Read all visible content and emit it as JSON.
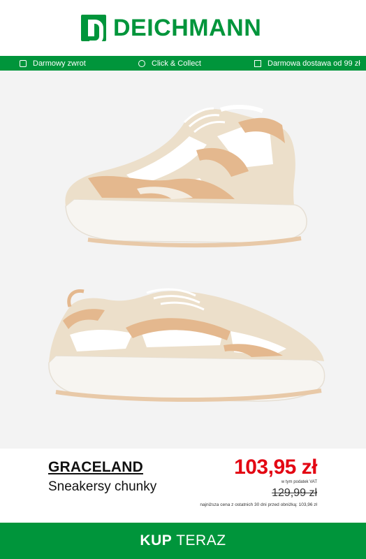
{
  "brand_logo": {
    "name": "DEICHMANN",
    "color": "#00953b"
  },
  "benefits": [
    {
      "icon": "return-box-icon",
      "label": "Darmowy zwrot"
    },
    {
      "icon": "location-pin-icon",
      "label": "Click & Collect"
    },
    {
      "icon": "delivery-box-icon",
      "label": "Darmowa dostawa od 99 zł"
    }
  ],
  "product": {
    "images": [
      {
        "alt": "shoe-side-view-upper"
      },
      {
        "alt": "shoe-side-view-lower"
      }
    ],
    "brand": "GRACELAND",
    "name": "Sneakersy chunky",
    "price": "103,95 zł",
    "vat_note": "w tym podatek VAT",
    "old_price": "129,99 zł",
    "lowest_price_note": "najniższa cena z ostatnich 30 dni przed obniżką: 103,96 zł"
  },
  "cta": {
    "label_bold": "KUP",
    "label_rest": " TERAZ"
  },
  "colors": {
    "accent_green": "#00953b",
    "price_red": "#e30613",
    "image_bg": "#f3f3f3"
  }
}
